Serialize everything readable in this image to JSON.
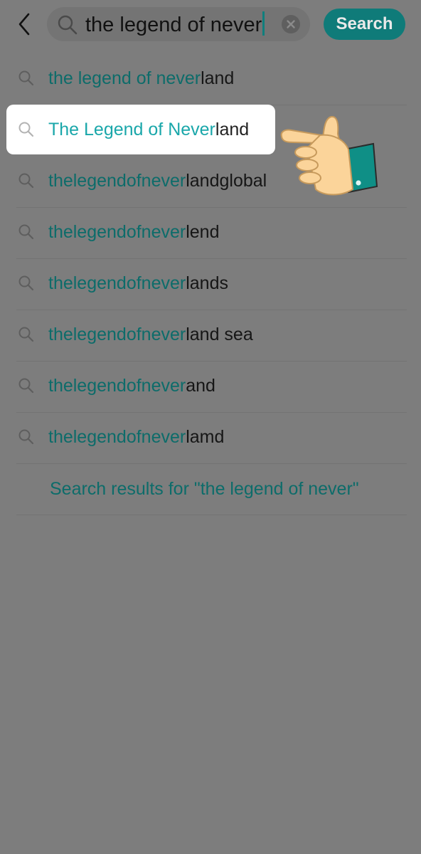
{
  "header": {
    "back_icon": "chevron-left-icon",
    "search_icon": "search-icon",
    "query": "the legend of never",
    "clear_icon": "clear-icon",
    "search_button_label": "Search"
  },
  "suggestions": [
    {
      "match": "the legend of never",
      "rest": "land"
    },
    {
      "match": "The Legend of Never",
      "rest": "land"
    },
    {
      "match": "thelegendofnever",
      "rest": "landglobal"
    },
    {
      "match": "thelegendofnever",
      "rest": "lend"
    },
    {
      "match": "thelegendofnever",
      "rest": "lands"
    },
    {
      "match": "thelegendofnever",
      "rest": "land sea"
    },
    {
      "match": "thelegendofnever",
      "rest": "and"
    },
    {
      "match": "thelegendofnever",
      "rest": "lamd"
    }
  ],
  "results_link": "Search results for \"the legend of never\"",
  "overlay": {
    "pointer_icon": "pointing-hand-icon"
  },
  "colors": {
    "accent": "#0f7b79",
    "highlight_text": "#1aa7aa",
    "dim_overlay": "#7d7d7d"
  }
}
